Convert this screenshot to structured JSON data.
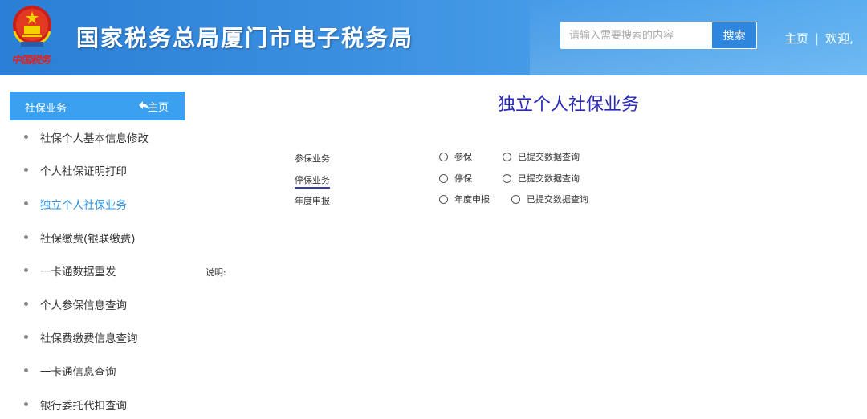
{
  "header": {
    "emblem_text": "中国税务",
    "site_title": "国家税务总局厦门市电子税务局",
    "search": {
      "placeholder": "请输入需要搜索的内容",
      "button": "搜索"
    },
    "nav": {
      "home": "主页",
      "separator": "|",
      "welcome": "欢迎,"
    }
  },
  "sidebar": {
    "title": "社保业务",
    "home_label": "主页",
    "items": [
      {
        "label": "社保个人基本信息修改"
      },
      {
        "label": "个人社保证明打印"
      },
      {
        "label": "独立个人社保业务"
      },
      {
        "label": "社保缴费(银联缴费)"
      },
      {
        "label": "一卡通数据重发"
      },
      {
        "label": "个人参保信息查询"
      },
      {
        "label": "社保费缴费信息查询"
      },
      {
        "label": "一卡通信息查询"
      },
      {
        "label": "银行委托代扣查询"
      }
    ],
    "active_index": 2
  },
  "main": {
    "title": "独立个人社保业务",
    "rows": [
      {
        "label": "参保业务",
        "opt1": "参保",
        "opt2": "已提交数据查询"
      },
      {
        "label": "停保业务",
        "opt1": "停保",
        "opt2": "已提交数据查询"
      },
      {
        "label": "年度申报",
        "opt1": "年度申报",
        "opt2": "已提交数据查询"
      }
    ],
    "note": "说明:"
  },
  "colors": {
    "header_blue": "#3b8fe0",
    "sidebar_head": "#3ca0f0",
    "active_item": "#2d8fe0",
    "title_blue": "#2a2ab8"
  }
}
